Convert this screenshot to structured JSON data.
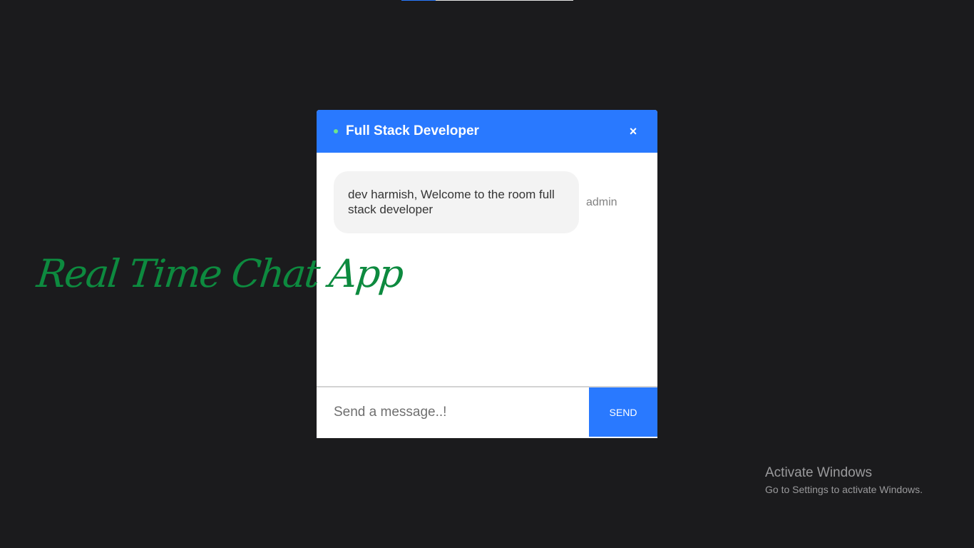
{
  "progress": {
    "fraction": 0.2
  },
  "brand": {
    "title": "Real Time Chat App",
    "color": "#0d8a3f"
  },
  "chat": {
    "accent_color": "#2979ff",
    "room_name": "Full Stack Developer",
    "close_icon": "close-icon",
    "close_glyph": "×",
    "messages": [
      {
        "text": "dev harmish, Welcome to the room full stack developer",
        "sender": "admin"
      }
    ],
    "input": {
      "value": "",
      "placeholder": "Send a message..!"
    },
    "send_label": "SEND"
  },
  "watermark": {
    "title": "Activate Windows",
    "subtitle": "Go to Settings to activate Windows."
  }
}
